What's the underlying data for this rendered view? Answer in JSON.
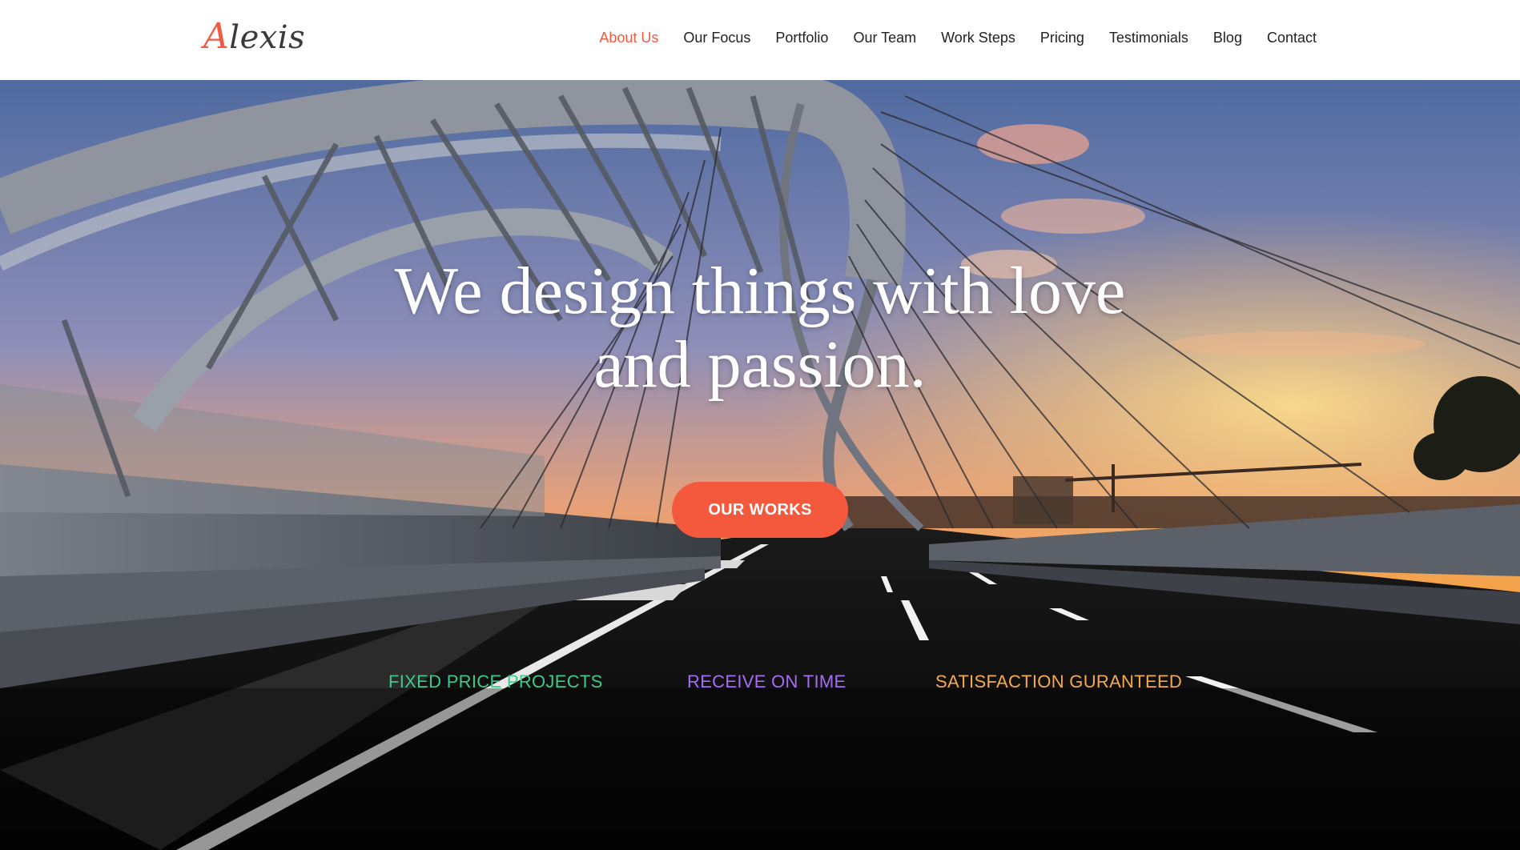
{
  "brand": {
    "logo_first": "A",
    "logo_rest": "lexis",
    "accent": "#f25a43"
  },
  "nav": {
    "items": [
      {
        "label": "About Us",
        "active": true
      },
      {
        "label": "Our Focus"
      },
      {
        "label": "Portfolio"
      },
      {
        "label": "Our Team"
      },
      {
        "label": "Work Steps"
      },
      {
        "label": "Pricing"
      },
      {
        "label": "Testimonials"
      },
      {
        "label": "Blog"
      },
      {
        "label": "Contact"
      }
    ]
  },
  "hero": {
    "headline_line1": "We design things with love",
    "headline_line2": "and passion.",
    "cta_label": "OUR WORKS",
    "cta_color": "#f5593d"
  },
  "features": [
    {
      "label": "FIXED PRICE PROJECTS",
      "color": "#3ec98a"
    },
    {
      "label": "RECEIVE ON TIME",
      "color": "#a56cf5"
    },
    {
      "label": "SATISFACTION GURANTEED",
      "color": "#f5a94a"
    }
  ]
}
